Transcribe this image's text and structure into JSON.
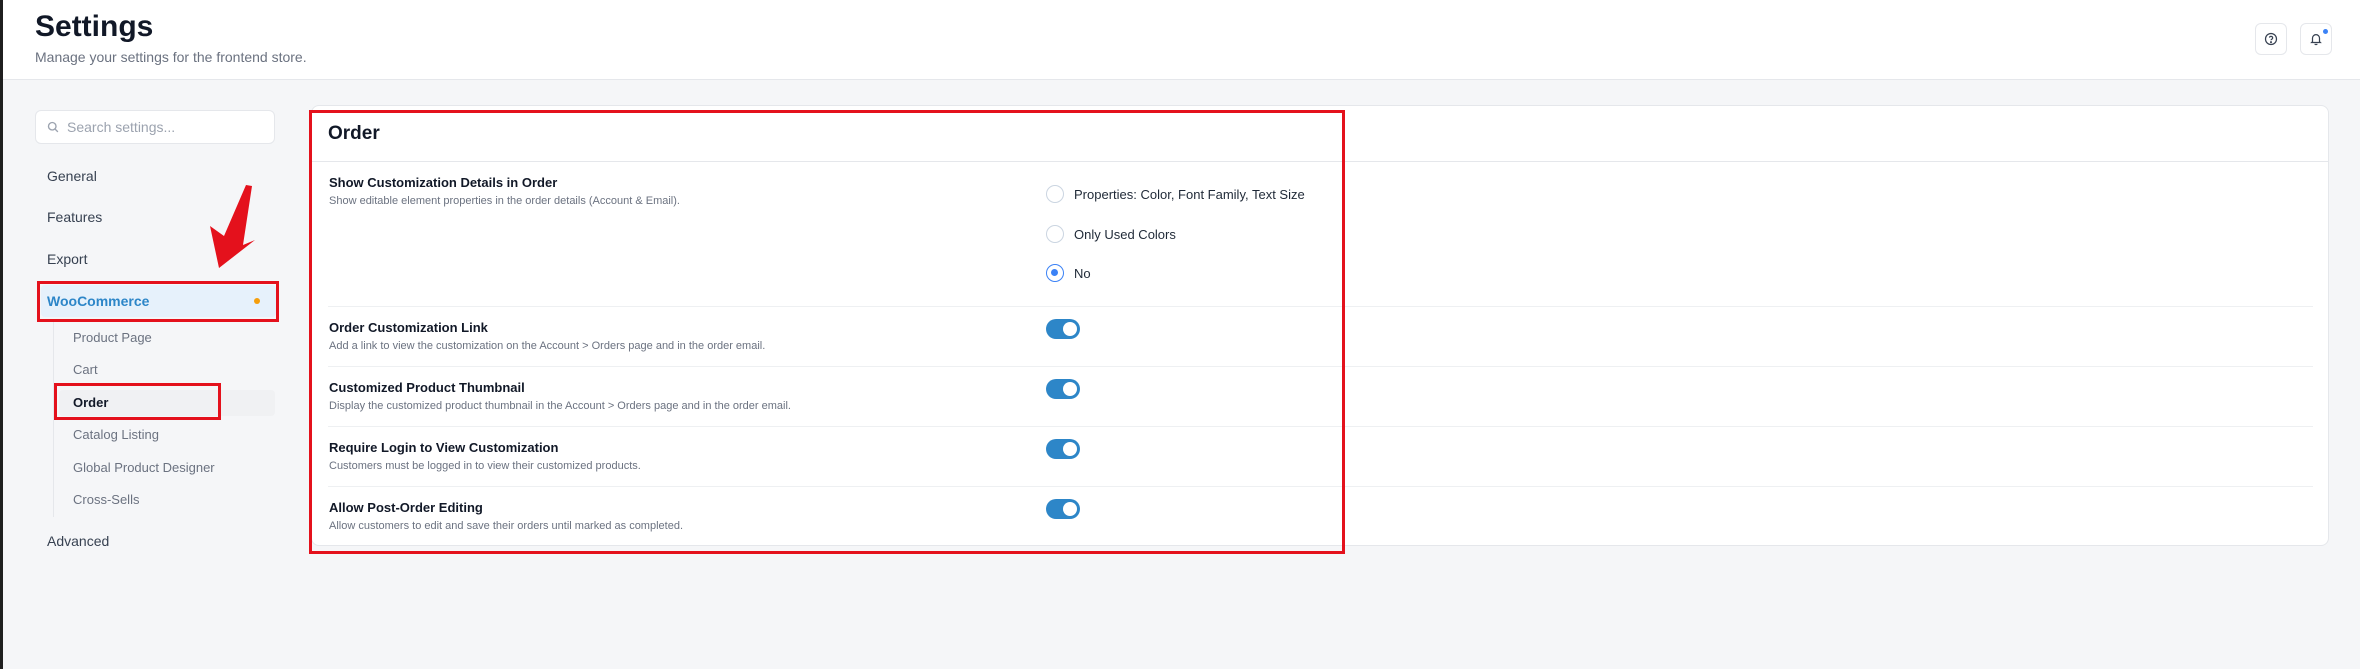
{
  "header": {
    "title": "Settings",
    "subtitle": "Manage your settings for the frontend store.",
    "help_icon": "help-circle-icon",
    "notification_icon": "bell-icon"
  },
  "sidebar": {
    "search_placeholder": "Search settings...",
    "items": [
      {
        "label": "General"
      },
      {
        "label": "Features"
      },
      {
        "label": "Export"
      },
      {
        "label": "WooCommerce"
      },
      {
        "label": "Advanced"
      }
    ],
    "woocommerce_children": [
      {
        "label": "Product Page"
      },
      {
        "label": "Cart"
      },
      {
        "label": "Order"
      },
      {
        "label": "Catalog Listing"
      },
      {
        "label": "Global Product Designer"
      },
      {
        "label": "Cross-Sells"
      }
    ]
  },
  "panel": {
    "title": "Order",
    "settings": [
      {
        "title": "Show Customization Details in Order",
        "description": "Show editable element properties in the order details (Account & Email).",
        "options": [
          {
            "label": "Properties: Color, Font Family, Text Size",
            "checked": false
          },
          {
            "label": "Only Used Colors",
            "checked": false
          },
          {
            "label": "No",
            "checked": true
          }
        ]
      },
      {
        "title": "Order Customization Link",
        "description": "Add a link to view the customization on the Account > Orders page and in the order email.",
        "enabled": true
      },
      {
        "title": "Customized Product Thumbnail",
        "description": "Display the customized product thumbnail in the Account > Orders page and in the order email.",
        "enabled": true
      },
      {
        "title": "Require Login to View Customization",
        "description": "Customers must be logged in to view their customized products.",
        "enabled": true
      },
      {
        "title": "Allow Post-Order Editing",
        "description": "Allow customers to edit and save their orders until marked as completed.",
        "enabled": true
      }
    ]
  },
  "colors": {
    "accent": "#2d86c8",
    "active_bg": "#e6f1fb",
    "badge_dot": "#f59e0b",
    "annotation": "#e4111c"
  }
}
